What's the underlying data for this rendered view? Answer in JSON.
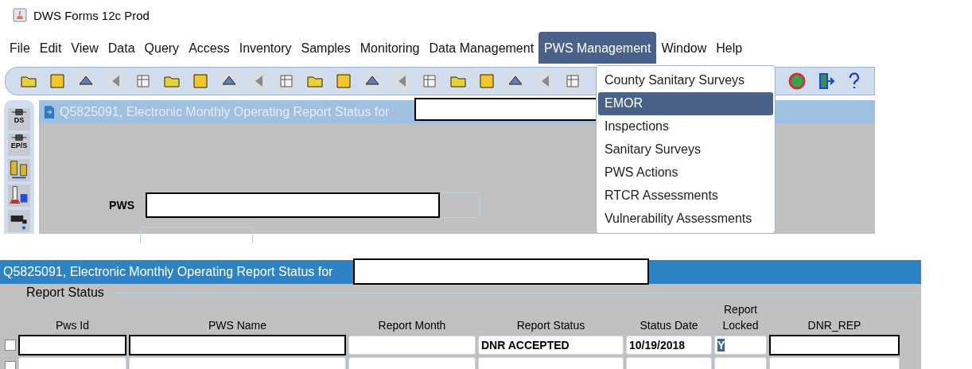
{
  "window": {
    "title": "DWS Forms 12c Prod"
  },
  "menu_bar": [
    {
      "label": "File",
      "selected": false
    },
    {
      "label": "Edit",
      "selected": false
    },
    {
      "label": "View",
      "selected": false
    },
    {
      "label": "Data",
      "selected": false
    },
    {
      "label": "Query",
      "selected": false
    },
    {
      "label": "Access",
      "selected": false
    },
    {
      "label": "Inventory",
      "selected": false
    },
    {
      "label": "Samples",
      "selected": false
    },
    {
      "label": "Monitoring",
      "selected": false
    },
    {
      "label": "Data Management",
      "selected": false
    },
    {
      "label": "PWS Management",
      "selected": true
    },
    {
      "label": "Window",
      "selected": false
    },
    {
      "label": "Help",
      "selected": false
    }
  ],
  "dropdown_menu": {
    "items": [
      {
        "label": "County Sanitary Surveys",
        "selected": false
      },
      {
        "label": "EMOR",
        "selected": true
      },
      {
        "label": "Inspections",
        "selected": false
      },
      {
        "label": "Sanitary Surveys",
        "selected": false
      },
      {
        "label": "PWS Actions",
        "selected": false
      },
      {
        "label": "RTCR Assessments",
        "selected": false
      },
      {
        "label": "Vulnerability Assessments",
        "selected": false
      }
    ]
  },
  "sidebar": {
    "items": [
      {
        "kind": "ds",
        "label": "DS"
      },
      {
        "kind": "eps",
        "label": "EP/S"
      },
      {
        "kind": "cylinders"
      },
      {
        "kind": "lab"
      },
      {
        "kind": "tap"
      }
    ]
  },
  "form_window": {
    "title": "Q5825091, Electronic Monthly Operating Report Status for",
    "fields": [
      {
        "label": "PWS",
        "redacted": true
      }
    ]
  },
  "report_window": {
    "title": "Q5825091, Electronic Monthly Operating Report Status for",
    "section": "Report Status",
    "columns": [
      "Pws Id",
      "PWS Name",
      "Report Month",
      "Report Status",
      "Status Date",
      "Report Locked",
      "DNR_REP"
    ],
    "rows": [
      {
        "checked": false,
        "cells": [
          {
            "redacted": true
          },
          {
            "redacted": true
          },
          {
            "redacted": false
          },
          {
            "text": "DNR ACCEPTED",
            "highlighted": false,
            "redacted": false
          },
          {
            "text": "10/19/2018",
            "highlighted": false,
            "redacted": false
          },
          {
            "text": "Y",
            "highlighted": true,
            "redacted": false
          },
          {
            "redacted": true
          }
        ]
      },
      {
        "checked": false,
        "cells": [
          {
            "redacted": false
          },
          {
            "redacted": false
          },
          {
            "redacted": false
          },
          {
            "redacted": false
          },
          {
            "redacted": false
          },
          {
            "redacted": false
          },
          {
            "redacted": false
          }
        ]
      }
    ]
  }
}
